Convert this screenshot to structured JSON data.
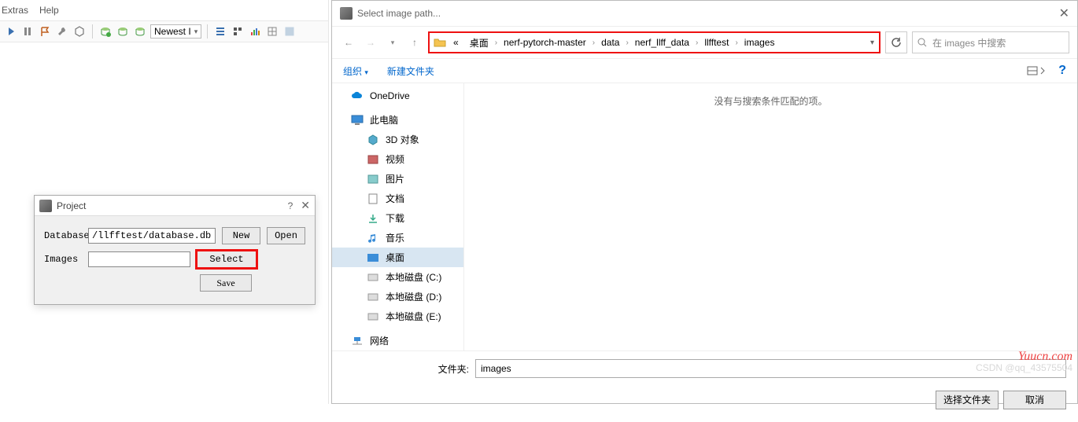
{
  "menu": {
    "extras": "Extras",
    "help": "Help"
  },
  "toolbar": {
    "combo": "Newest I"
  },
  "project": {
    "title": "Project",
    "database_label": "Database",
    "database_value": "/llfftest/database.db",
    "images_label": "Images",
    "images_value": "",
    "new": "New",
    "open": "Open",
    "select": "Select",
    "save": "Save"
  },
  "filedialog": {
    "title": "Select image path...",
    "breadcrumb": [
      "«",
      "桌面",
      "nerf-pytorch-master",
      "data",
      "nerf_llff_data",
      "llfftest",
      "images"
    ],
    "search_placeholder": "在 images 中搜索",
    "organize": "组织",
    "new_folder": "新建文件夹",
    "empty_msg": "没有与搜索条件匹配的项。",
    "tree": {
      "onedrive": "OneDrive",
      "thispc": "此电脑",
      "objects3d": "3D 对象",
      "videos": "视频",
      "pictures": "图片",
      "documents": "文档",
      "downloads": "下载",
      "music": "音乐",
      "desktop": "桌面",
      "diskc": "本地磁盘 (C:)",
      "diskd": "本地磁盘 (D:)",
      "diske": "本地磁盘 (E:)",
      "network": "网络"
    },
    "folder_label": "文件夹:",
    "folder_value": "images",
    "select_folder": "选择文件夹",
    "cancel": "取消"
  },
  "watermark": {
    "brand": "Yuucn.com",
    "sub": "CSDN @qq_43575504"
  }
}
